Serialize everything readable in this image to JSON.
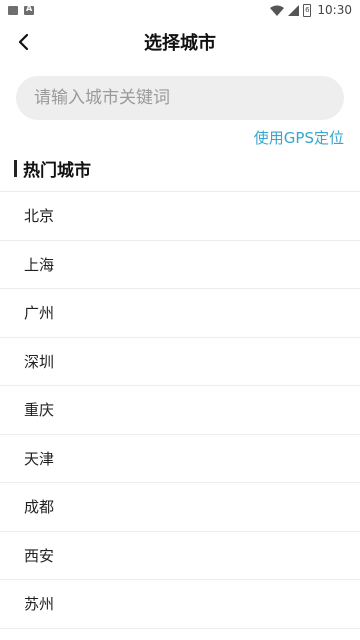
{
  "statusbar": {
    "time": "10:30",
    "battery": "6"
  },
  "header": {
    "title": "选择城市"
  },
  "search": {
    "placeholder": "请输入城市关键词",
    "value": ""
  },
  "gps": {
    "label": "使用GPS定位"
  },
  "hot_cities": {
    "title": "热门城市",
    "items": [
      "北京",
      "上海",
      "广州",
      "深圳",
      "重庆",
      "天津",
      "成都",
      "西安",
      "苏州"
    ]
  },
  "colors": {
    "accent": "#36a6cf",
    "search_bg": "#eeeeee",
    "divider": "#ececec"
  }
}
